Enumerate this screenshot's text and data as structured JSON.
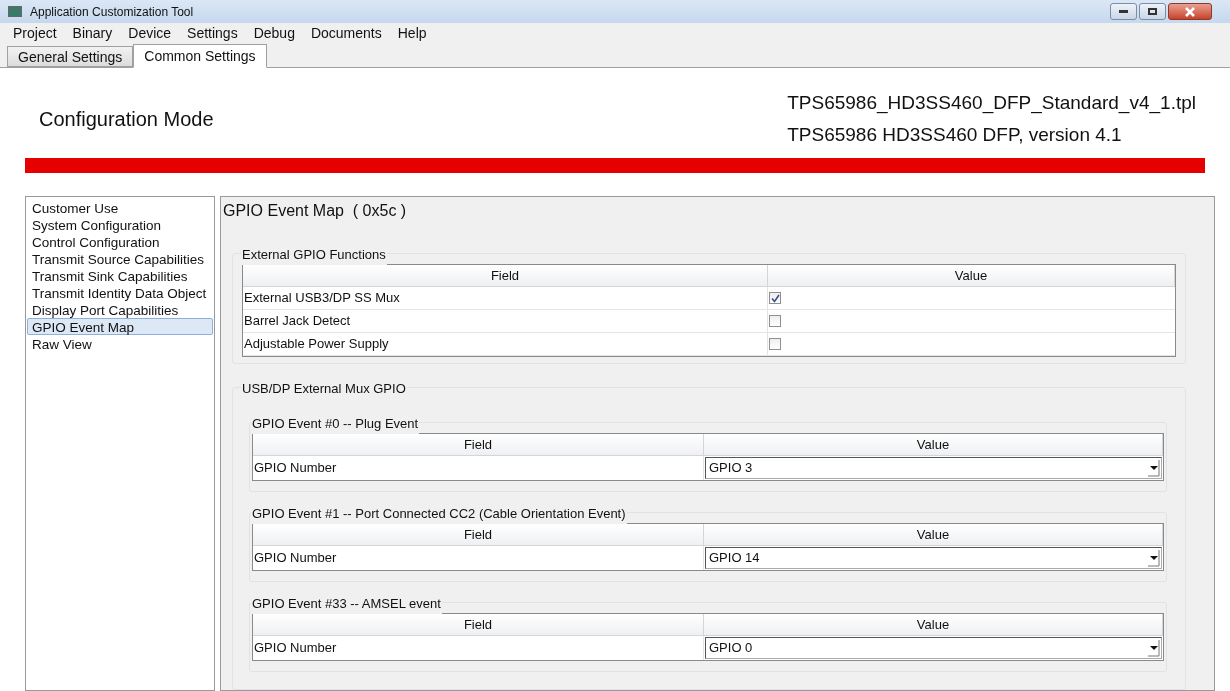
{
  "window": {
    "title": "Application Customization Tool"
  },
  "menu": [
    "Project",
    "Binary",
    "Device",
    "Settings",
    "Debug",
    "Documents",
    "Help"
  ],
  "tabs": [
    {
      "label": "General Settings",
      "selected": false
    },
    {
      "label": "Common Settings",
      "selected": true
    }
  ],
  "header": {
    "mode": "Configuration Mode",
    "file": "TPS65986_HD3SS460_DFP_Standard_v4_1.tpl",
    "device": "TPS65986 HD3SS460 DFP, version 4.1"
  },
  "sidebar": {
    "items": [
      {
        "label": "Customer Use",
        "selected": false
      },
      {
        "label": "System Configuration",
        "selected": false
      },
      {
        "label": "Control Configuration",
        "selected": false
      },
      {
        "label": "Transmit Source Capabilities",
        "selected": false
      },
      {
        "label": "Transmit Sink Capabilities",
        "selected": false
      },
      {
        "label": "Transmit Identity Data Object",
        "selected": false
      },
      {
        "label": "Display Port Capabilities",
        "selected": false
      },
      {
        "label": "GPIO Event Map",
        "selected": true
      },
      {
        "label": "Raw View",
        "selected": false
      }
    ]
  },
  "panel": {
    "title": "GPIO Event Map  ( 0x5c )",
    "functions": {
      "title": "External GPIO Functions",
      "columns": [
        "Field",
        "Value"
      ],
      "rows": [
        {
          "field": "External USB3/DP SS Mux",
          "checked": true
        },
        {
          "field": "Barrel Jack Detect",
          "checked": false
        },
        {
          "field": "Adjustable Power Supply",
          "checked": false
        }
      ]
    },
    "mux": {
      "title": "USB/DP External Mux GPIO",
      "events": [
        {
          "title": "GPIO Event #0 -- Plug Event",
          "columns": [
            "Field",
            "Value"
          ],
          "field": "GPIO Number",
          "value": "GPIO 3"
        },
        {
          "title": "GPIO Event #1 -- Port Connected CC2 (Cable Orientation Event)",
          "columns": [
            "Field",
            "Value"
          ],
          "field": "GPIO Number",
          "value": "GPIO 14"
        },
        {
          "title": "GPIO Event #33 -- AMSEL event",
          "columns": [
            "Field",
            "Value"
          ],
          "field": "GPIO Number",
          "value": "GPIO 0"
        }
      ]
    }
  }
}
